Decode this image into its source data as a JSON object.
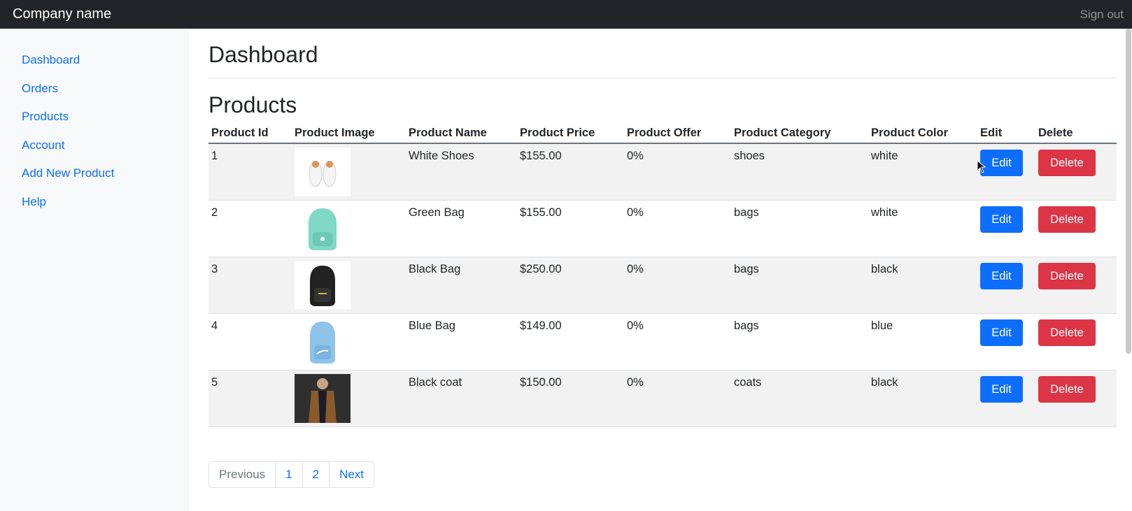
{
  "navbar": {
    "brand": "Company name",
    "signout": "Sign out"
  },
  "sidebar": {
    "items": [
      {
        "label": "Dashboard"
      },
      {
        "label": "Orders"
      },
      {
        "label": "Products"
      },
      {
        "label": "Account"
      },
      {
        "label": "Add New Product"
      },
      {
        "label": "Help"
      }
    ]
  },
  "main": {
    "page_title": "Dashboard",
    "section_title": "Products"
  },
  "table": {
    "headers": [
      "Product Id",
      "Product Image",
      "Product Name",
      "Product Price",
      "Product Offer",
      "Product Category",
      "Product Color",
      "Edit",
      "Delete"
    ],
    "rows": [
      {
        "id": "1",
        "image": "white-shoes-icon",
        "name": "White Shoes",
        "price": "$155.00",
        "offer": "0%",
        "category": "shoes",
        "color": "white",
        "edit": "Edit",
        "delete": "Delete"
      },
      {
        "id": "2",
        "image": "green-bag-icon",
        "name": "Green Bag",
        "price": "$155.00",
        "offer": "0%",
        "category": "bags",
        "color": "white",
        "edit": "Edit",
        "delete": "Delete"
      },
      {
        "id": "3",
        "image": "black-bag-icon",
        "name": "Black Bag",
        "price": "$250.00",
        "offer": "0%",
        "category": "bags",
        "color": "black",
        "edit": "Edit",
        "delete": "Delete"
      },
      {
        "id": "4",
        "image": "blue-bag-icon",
        "name": "Blue Bag",
        "price": "$149.00",
        "offer": "0%",
        "category": "bags",
        "color": "blue",
        "edit": "Edit",
        "delete": "Delete"
      },
      {
        "id": "5",
        "image": "black-coat-icon",
        "name": "Black coat",
        "price": "$150.00",
        "offer": "0%",
        "category": "coats",
        "color": "black",
        "edit": "Edit",
        "delete": "Delete"
      }
    ]
  },
  "pagination": {
    "previous": "Previous",
    "page1": "1",
    "page2": "2",
    "next": "Next"
  },
  "colors": {
    "primary": "#0d6efd",
    "danger": "#dc3545",
    "navbar": "#212529"
  }
}
